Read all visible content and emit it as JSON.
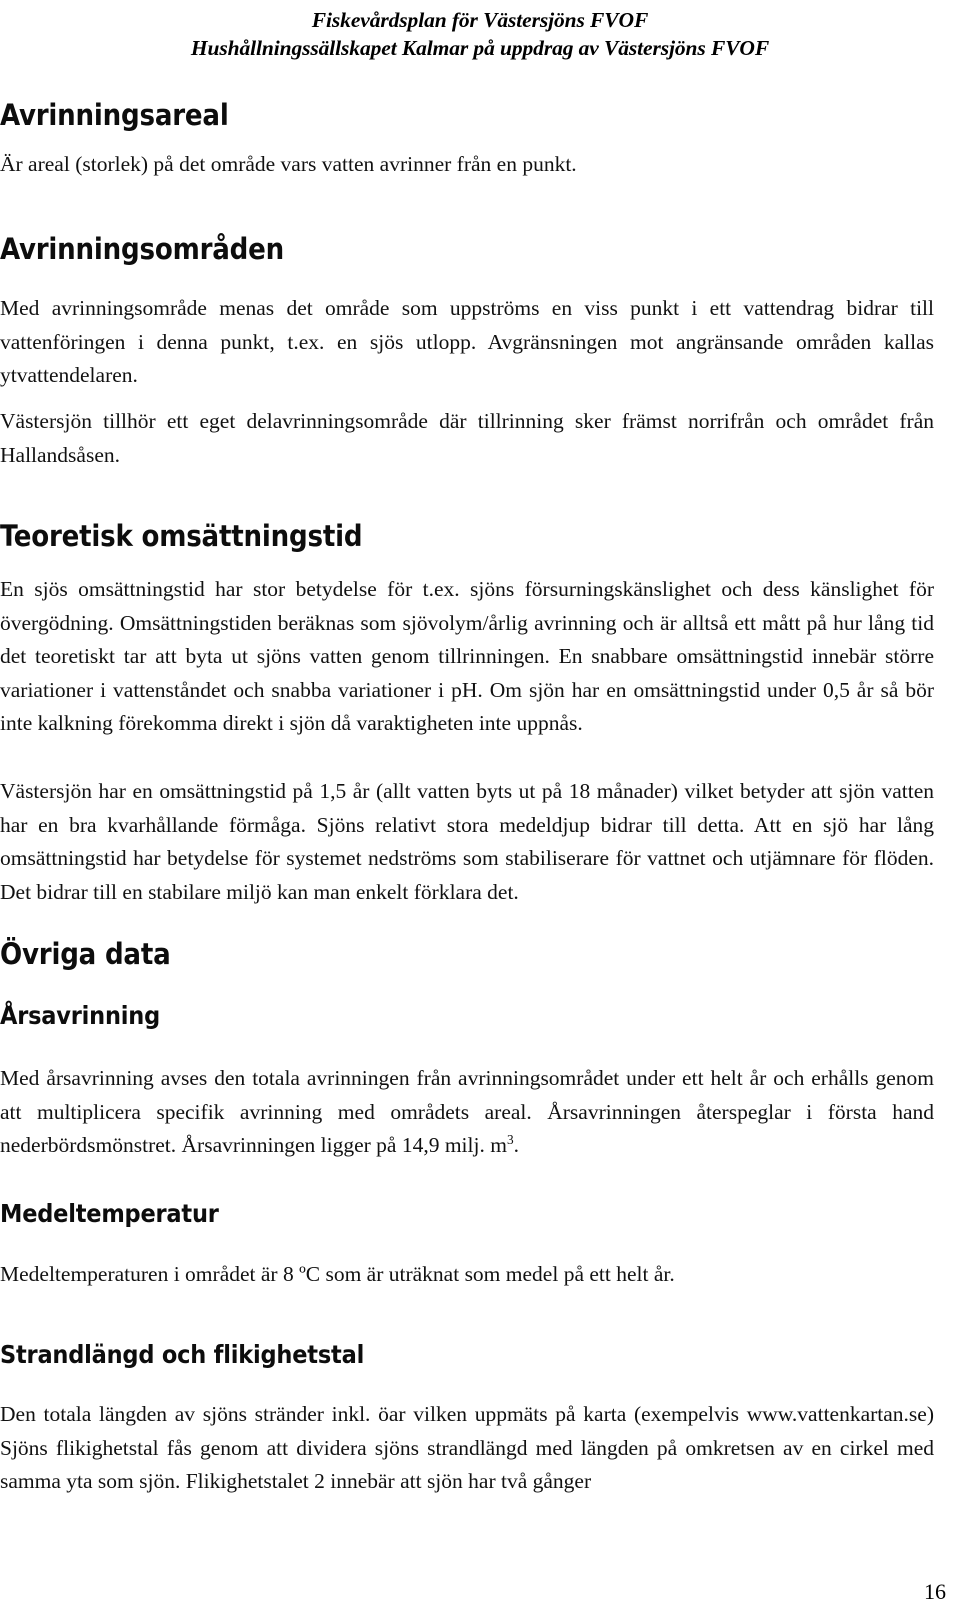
{
  "document": {
    "header": {
      "line1": "Fiskevårdsplan för Västersjöns FVOF",
      "line2": "Hushållningssällskapet Kalmar på uppdrag av Västersjöns FVOF"
    },
    "page_number": "16"
  },
  "sections": [
    {
      "id": "avrinningsareal",
      "heading": "Avrinningsareal",
      "level": 1,
      "paragraphs": [
        "Är areal (storlek) på det område vars vatten avrinner från en punkt."
      ]
    },
    {
      "id": "avrinningsomraden",
      "heading": "Avrinningsområden",
      "level": 1,
      "paragraphs": [
        "Med avrinningsområde menas det område som uppströms en viss punkt i ett vattendrag bidrar till vattenföringen i denna punkt, t.ex. en sjös utlopp. Avgränsningen mot angränsande områden kallas ytvattendelaren.",
        "Västersjön tillhör ett eget delavrinningsområde där tillrinning sker främst norrifrån och området från Hallandsåsen."
      ]
    },
    {
      "id": "teoretisk-omsattningstid",
      "heading": "Teoretisk omsättningstid",
      "level": 1,
      "paragraphs": [
        "En sjös omsättningstid har stor betydelse för t.ex. sjöns försurningskänslighet och dess känslighet för övergödning. Omsättningstiden beräknas som sjövolym/årlig avrinning och är alltså ett mått på hur lång tid det teoretiskt tar att byta ut sjöns vatten genom tillrinningen. En snabbare omsättningstid innebär större variationer i vattenståndet och snabba variationer i pH. Om sjön har en omsättningstid under 0,5 år så bör inte kalkning förekomma direkt i sjön då varaktigheten inte uppnås.",
        "Västersjön har en omsättningstid på 1,5 år (allt vatten byts ut på 18 månader) vilket betyder att sjön vatten har en bra kvarhållande förmåga. Sjöns relativt stora medeldjup bidrar till detta. Att en sjö har lång omsättningstid har betydelse för systemet nedströms som stabiliserare för vattnet och utjämnare för flöden. Det bidrar till en stabilare miljö kan man enkelt förklara det."
      ]
    },
    {
      "id": "ovriga-data",
      "heading": "Övriga data",
      "level": 1,
      "paragraphs": []
    },
    {
      "id": "arsavrinning",
      "heading": "Årsavrinning",
      "level": 2,
      "paragraphs": [
        "Med årsavrinning avses den totala avrinningen från avrinningsområdet under ett helt år och erhålls genom att multiplicera specifik avrinning med områdets areal. Årsavrinningen återspeglar i första hand nederbördsmönstret. Årsavrinningen ligger på 14,9 milj. m"
      ],
      "paragraph_exponent": "3",
      "paragraph_tail": "."
    },
    {
      "id": "medeltemperatur",
      "heading": "Medeltemperatur",
      "level": 2,
      "paragraphs": [
        "Medeltemperaturen i området är 8 ºC som är uträknat som medel på ett helt år."
      ]
    },
    {
      "id": "strandlangd-och-flikighetstal",
      "heading": "Strandlängd och flikighetstal",
      "level": 2,
      "paragraphs": [
        "Den totala längden av sjöns stränder inkl. öar vilken uppmäts på karta (exempelvis www.vattenkartan.se) Sjöns flikighetstal fås genom att dividera sjöns strandlängd med längden på omkretsen av en cirkel med samma yta som sjön. Flikighetstalet 2 innebär att sjön har två gånger"
      ]
    }
  ]
}
